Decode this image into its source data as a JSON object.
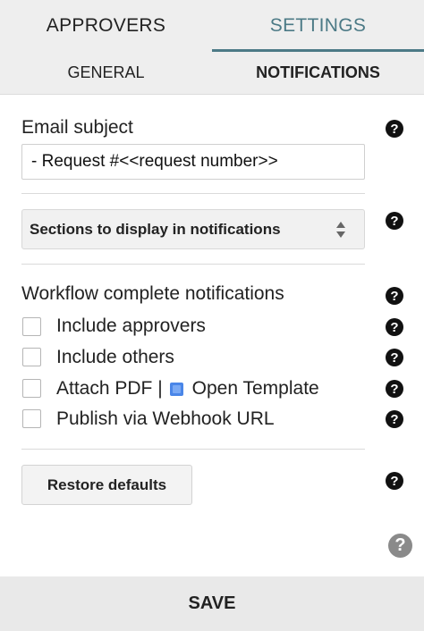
{
  "tabs": {
    "approvers": "APPROVERS",
    "settings": "SETTINGS"
  },
  "subtabs": {
    "general": "GENERAL",
    "notifications": "NOTIFICATIONS"
  },
  "email_subject": {
    "label": "Email subject",
    "value": "- Request #<<request number>>"
  },
  "sections_select": {
    "selected": "Sections to display in notifications"
  },
  "workflow": {
    "heading": "Workflow complete notifications",
    "options": [
      {
        "label": "Include approvers",
        "checked": false
      },
      {
        "label": "Include others",
        "checked": false
      },
      {
        "label": "Attach PDF |",
        "link": "Open Template",
        "checked": false
      },
      {
        "label": "Publish via Webhook URL",
        "checked": false
      }
    ]
  },
  "restore_label": "Restore defaults",
  "save_label": "SAVE",
  "help_glyph": "?",
  "icons": [
    "help-icon",
    "doc-icon",
    "select-arrows-icon"
  ],
  "colors": {
    "accent": "#4c7a86",
    "tab_bg": "#eeeeee",
    "doc_icon": "#4a86e8"
  }
}
